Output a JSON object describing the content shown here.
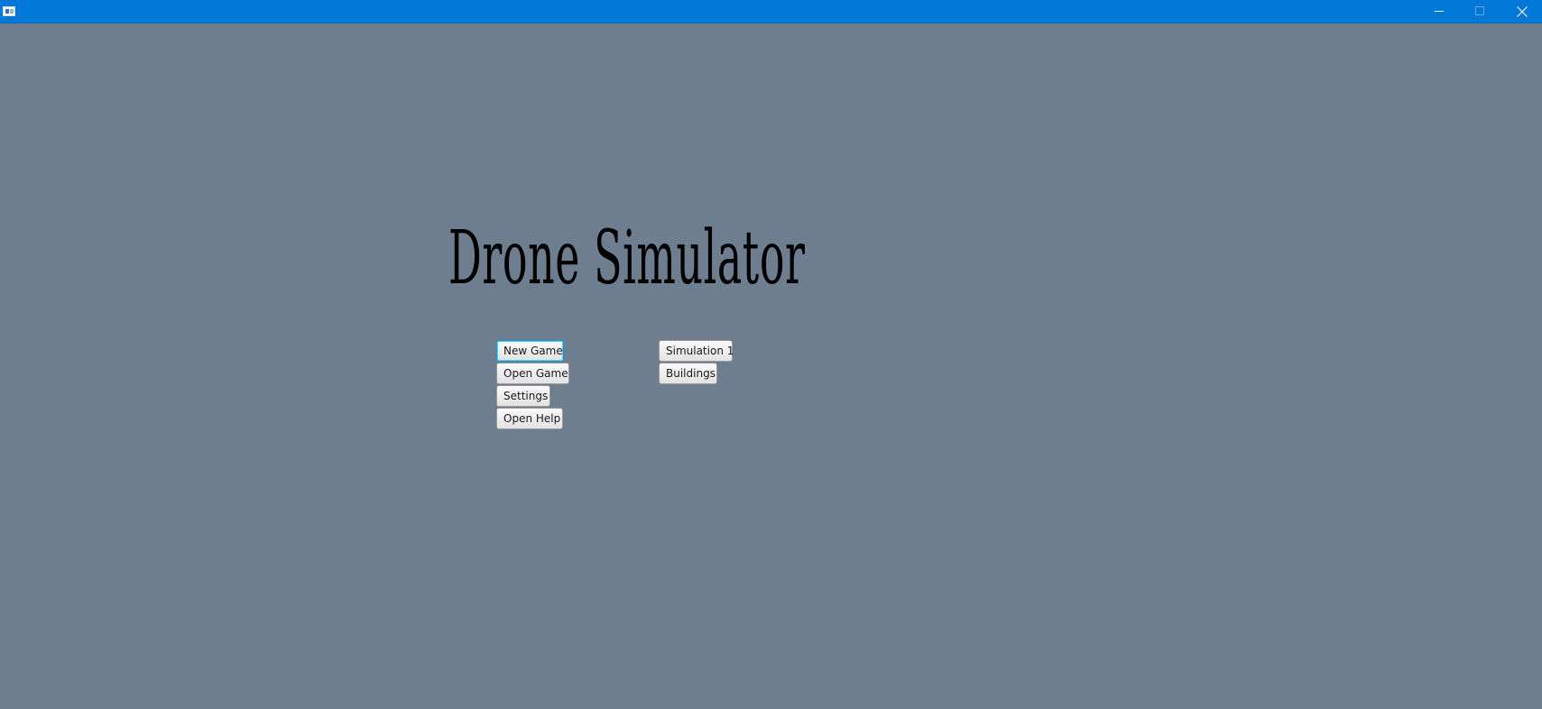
{
  "window": {
    "titlebar_color": "#0078d7",
    "background_color": "#6e7e8f",
    "controls": {
      "minimize_icon": "minimize-icon",
      "maximize_icon": "maximize-icon",
      "close_icon": "close-icon"
    }
  },
  "main": {
    "title": "Drone Simulator"
  },
  "menu_left": {
    "new_game_label": "New Game",
    "open_game_label": "Open Game",
    "settings_label": "Settings",
    "open_help_label": "Open Help"
  },
  "menu_right": {
    "simulation1_label": "Simulation 1",
    "buildings_label": "Buildings"
  }
}
